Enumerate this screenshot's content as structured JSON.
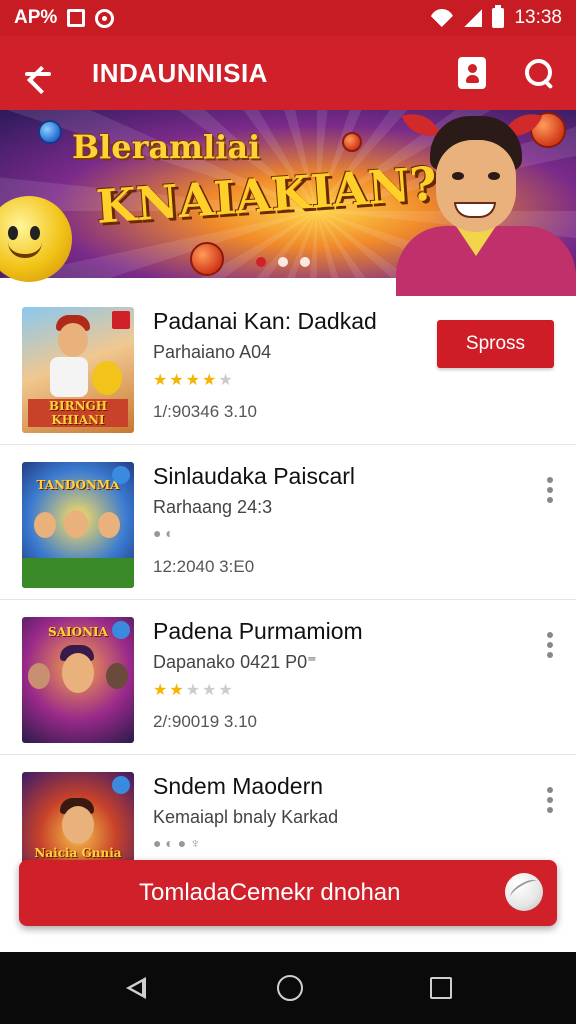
{
  "status_bar": {
    "left_text": "AP%",
    "time": "13:38"
  },
  "app_bar": {
    "title": "INDAUNNISIA"
  },
  "banner": {
    "line1": "Bleramliai",
    "line2": "KNAIAKIAN?",
    "dots": 3,
    "active_dot": 0
  },
  "items": [
    {
      "title": "Padanai Kan: Dadkad",
      "subtitle": "Parhaiano A04",
      "rating": 4,
      "rating_max": 5,
      "meta": "1/:90346 3.10",
      "button": "Spross",
      "thumb_text": "BIRNGH KHIANI"
    },
    {
      "title": "Sinlaudaka Paiscarl",
      "subtitle": "Rarhaang 24:3",
      "icons": "● ◐",
      "meta": "12:2040 3:E0",
      "thumb_text": "TANDONMA"
    },
    {
      "title": "Padena Purmamiom",
      "subtitle": "Dapanako 0421 P0⁼",
      "rating": 2,
      "rating_max": 5,
      "meta": "2/:90019 3.10",
      "thumb_text": "SAIONIA"
    },
    {
      "title": "Sndem Maodern",
      "subtitle": "Kemaiapl bnaly Karkad",
      "icons": "● ◐ ● ♆",
      "thumb_text": "Naicia Gnnia"
    }
  ],
  "cta": {
    "label": "TomladaCemekr dnohan"
  },
  "colors": {
    "primary": "#d0202a",
    "status_bar": "#c81c24",
    "star": "#f4b400"
  }
}
